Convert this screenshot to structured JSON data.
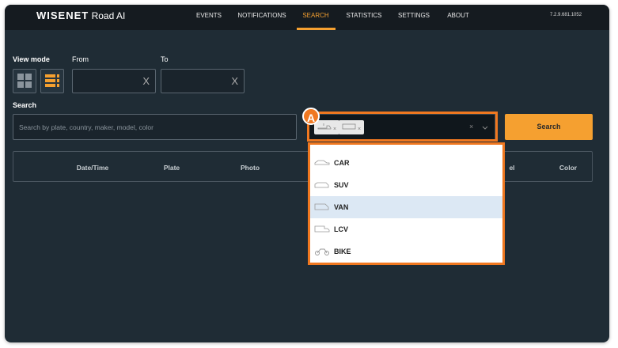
{
  "header": {
    "logo": "WISENET",
    "product": "Road AI",
    "version": "7.2.9.681.1052",
    "nav": [
      {
        "label": "EVENTS"
      },
      {
        "label": "NOTIFICATIONS"
      },
      {
        "label": "SEARCH",
        "active": true
      },
      {
        "label": "STATISTICS"
      },
      {
        "label": "SETTINGS"
      },
      {
        "label": "ABOUT"
      }
    ]
  },
  "filters": {
    "view_mode_label": "View mode",
    "from_label": "From",
    "to_label": "To",
    "from_value": "",
    "to_value": "",
    "clear": "X",
    "search_label": "Search",
    "search_placeholder": "Search by plate, country, maker, model, color",
    "search_button": "Search",
    "vehicle_tags": [
      {
        "icon": "truck-icon",
        "remove": "×"
      },
      {
        "icon": "bus-icon",
        "remove": "×"
      }
    ],
    "clear_all": "×"
  },
  "table": {
    "columns": [
      "Date/Time",
      "Plate",
      "Photo",
      "el",
      "Color"
    ]
  },
  "dropdown": {
    "items": [
      {
        "label": "CAR"
      },
      {
        "label": "SUV"
      },
      {
        "label": "VAN",
        "highlighted": true
      },
      {
        "label": "LCV"
      },
      {
        "label": "BIKE"
      }
    ]
  },
  "annotation": {
    "label": "A"
  },
  "colors": {
    "accent": "#f5a030",
    "annotation": "#f07820"
  }
}
